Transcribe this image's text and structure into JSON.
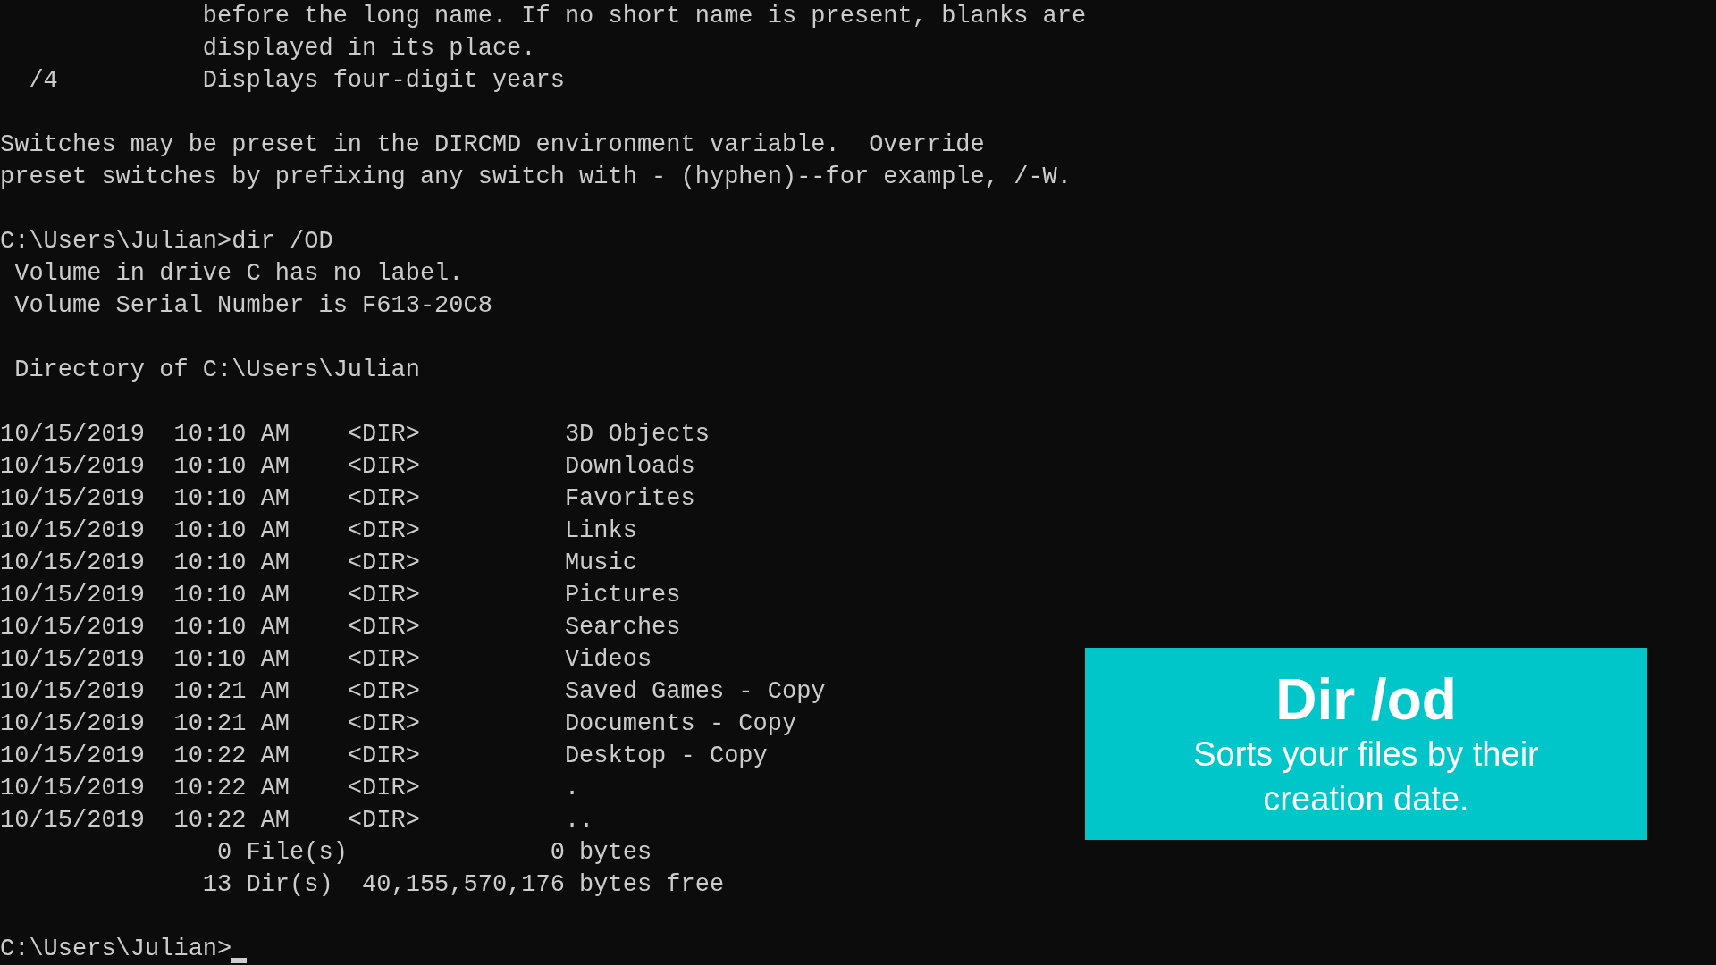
{
  "terminal": {
    "blocks": [
      [
        "              before the long name. If no short name is present, blanks are",
        "              displayed in its place.",
        "  /4          Displays four-digit years"
      ],
      [
        "Switches may be preset in the DIRCMD environment variable.  Override",
        "preset switches by prefixing any switch with - (hyphen)--for example, /-W."
      ],
      [
        "C:\\Users\\Julian>dir /OD",
        " Volume in drive C has no label.",
        " Volume Serial Number is F613-20C8"
      ],
      [
        " Directory of C:\\Users\\Julian"
      ],
      [
        "10/15/2019  10:10 AM    <DIR>          3D Objects",
        "10/15/2019  10:10 AM    <DIR>          Downloads",
        "10/15/2019  10:10 AM    <DIR>          Favorites",
        "10/15/2019  10:10 AM    <DIR>          Links",
        "10/15/2019  10:10 AM    <DIR>          Music",
        "10/15/2019  10:10 AM    <DIR>          Pictures",
        "10/15/2019  10:10 AM    <DIR>          Searches",
        "10/15/2019  10:10 AM    <DIR>          Videos",
        "10/15/2019  10:21 AM    <DIR>          Saved Games - Copy",
        "10/15/2019  10:21 AM    <DIR>          Documents - Copy",
        "10/15/2019  10:22 AM    <DIR>          Desktop - Copy",
        "10/15/2019  10:22 AM    <DIR>          .",
        "10/15/2019  10:22 AM    <DIR>          ..",
        "               0 File(s)              0 bytes",
        "              13 Dir(s)  40,155,570,176 bytes free"
      ]
    ],
    "prompt": "C:\\Users\\Julian>"
  },
  "caption": {
    "title": "Dir /od",
    "text": "Sorts your files by their creation date."
  }
}
